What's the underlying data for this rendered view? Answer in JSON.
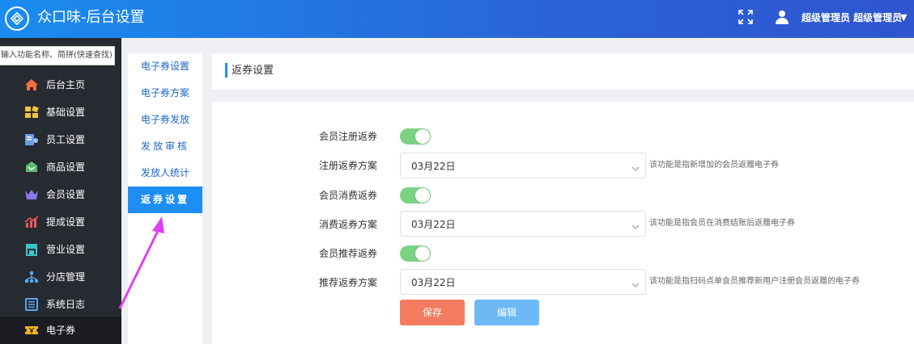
{
  "header": {
    "app_title": "众口味-后台设置",
    "user_name": "超级管理员 超级管理员",
    "caret": "▼",
    "icons": [
      "logo-icon",
      "fullscreen-icon",
      "user-icon",
      "caret-down-icon"
    ]
  },
  "sidebar": {
    "search_placeholder": "输入功能名称、简拼(快速查找)",
    "items": [
      {
        "label": "后台主页",
        "icon": "home-icon",
        "color": "#f07040"
      },
      {
        "label": "基础设置",
        "icon": "settings-blocks-icon",
        "color": "#f3c23c"
      },
      {
        "label": "员工设置",
        "icon": "employee-icon",
        "color": "#6f9be8"
      },
      {
        "label": "商品设置",
        "icon": "goods-icon",
        "color": "#5cbf6a"
      },
      {
        "label": "会员设置",
        "icon": "crown-icon",
        "color": "#8d7ae6"
      },
      {
        "label": "提成设置",
        "icon": "commission-chart-icon",
        "color": "#f05a5a"
      },
      {
        "label": "营业设置",
        "icon": "store-icon",
        "color": "#38c5c9"
      },
      {
        "label": "分店管理",
        "icon": "branch-icon",
        "color": "#5aa6f0"
      },
      {
        "label": "系统日志",
        "icon": "log-icon",
        "color": "#5aa6f0"
      },
      {
        "label": "电子券",
        "icon": "coupon-icon",
        "color": "#f0b428"
      }
    ]
  },
  "submenu": {
    "items": [
      {
        "label": "电子券设置"
      },
      {
        "label": "电子券方案"
      },
      {
        "label": "电子券发放"
      },
      {
        "label": "发放审核"
      },
      {
        "label": "发放人统计"
      },
      {
        "label": "返券设置"
      }
    ],
    "active_index": 5
  },
  "content": {
    "title": "返券设置",
    "rows": [
      {
        "label": "会员注册返券",
        "type": "toggle",
        "on": true
      },
      {
        "label": "注册返券方案",
        "type": "select",
        "value": "03月22日",
        "hint": "该功能是指新增加的会员返赠电子券"
      },
      {
        "label": "会员消费返券",
        "type": "toggle",
        "on": true
      },
      {
        "label": "消费返券方案",
        "type": "select",
        "value": "03月22日",
        "hint": "该功能是指会员在消费结账后返赠电子券"
      },
      {
        "label": "会员推荐返券",
        "type": "toggle",
        "on": true
      },
      {
        "label": "推荐返券方案",
        "type": "select",
        "value": "03月22日",
        "hint": "该功能是指扫码点单会员推荐新用户注册会员返赠的电子券"
      }
    ],
    "save_label": "保存",
    "edit_label": "编辑"
  },
  "colors": {
    "header_start": "#1a8cf0",
    "header_end": "#2f55cf",
    "sidebar_bg": "#262a31",
    "accent": "#1e8ef5",
    "toggle_on": "#7bd283",
    "save_button": "#f47b60",
    "edit_button": "#6db9f6",
    "annotation_arrow": "#e040f0"
  }
}
